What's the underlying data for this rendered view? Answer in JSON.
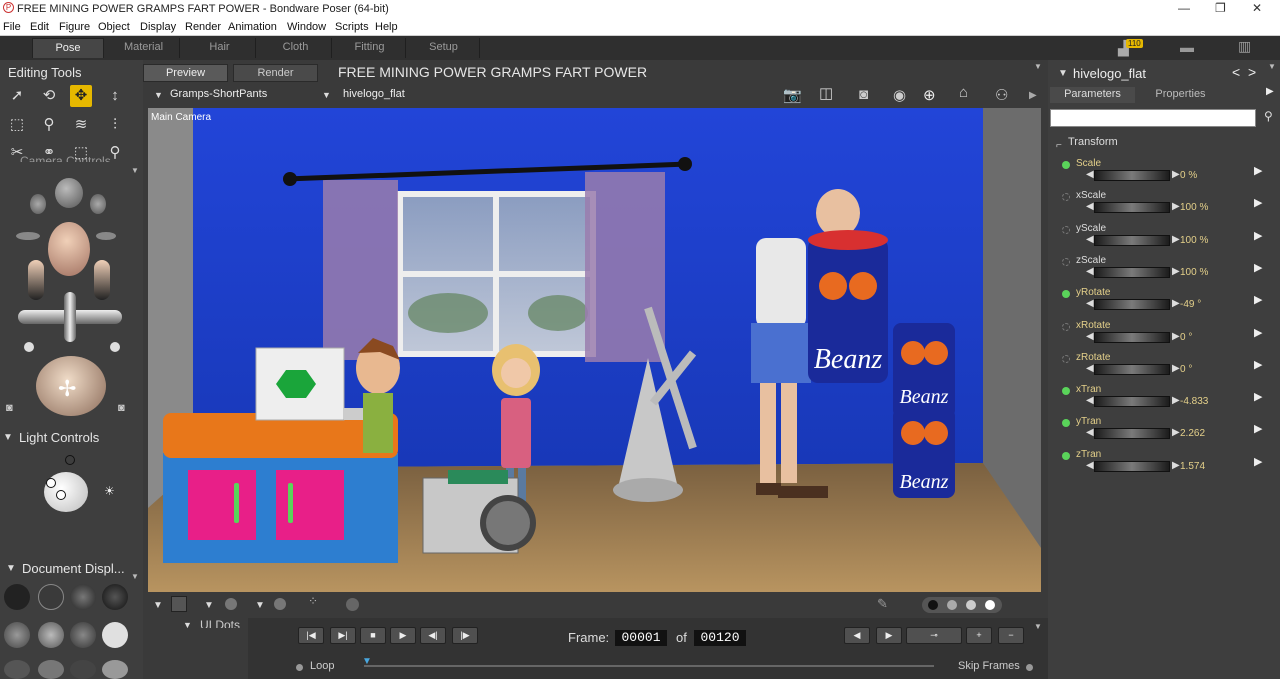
{
  "window": {
    "title": "FREE MINING POWER GRAMPS FART POWER - Bondware Poser (64-bit)"
  },
  "menu": [
    "File",
    "Edit",
    "Figure",
    "Object",
    "Display",
    "Render",
    "Animation",
    "Window",
    "Scripts",
    "Help"
  ],
  "rooms": [
    "Pose",
    "Material",
    "Hair",
    "Cloth",
    "Fitting",
    "Setup"
  ],
  "notification_count": "110",
  "left": {
    "editing_tools": "Editing Tools",
    "camera_controls": "Camera Controls",
    "light_controls": "Light Controls",
    "document_display": "Document Displ...",
    "ui_dots": "UI Dots"
  },
  "center": {
    "tabs": [
      "Preview",
      "Render"
    ],
    "scene_title": "FREE MINING POWER GRAMPS FART POWER",
    "figure_select": "Gramps-ShortPants",
    "actor_select": "hivelogo_flat",
    "camera_label": "Main Camera"
  },
  "timeline": {
    "frame_label": "Frame:",
    "current_frame": "00001",
    "of_label": "of",
    "total_frames": "00120",
    "loop": "Loop",
    "skip_frames": "Skip Frames"
  },
  "right": {
    "actor_name": "hivelogo_flat",
    "tabs": [
      "Parameters",
      "Properties"
    ],
    "group": "Transform",
    "params": [
      {
        "name": "Scale",
        "value": "0 %",
        "color": "#e4d08a",
        "dot": "#5ad45a"
      },
      {
        "name": "xScale",
        "value": "100 %",
        "color": "#ddd",
        "dot": "none"
      },
      {
        "name": "yScale",
        "value": "100 %",
        "color": "#ddd",
        "dot": "none"
      },
      {
        "name": "zScale",
        "value": "100 %",
        "color": "#ddd",
        "dot": "none"
      },
      {
        "name": "yRotate",
        "value": "-49 °",
        "color": "#e4d08a",
        "dot": "#5ad45a"
      },
      {
        "name": "xRotate",
        "value": "0 °",
        "color": "#e4d08a",
        "dot": "none"
      },
      {
        "name": "zRotate",
        "value": "0 °",
        "color": "#e4d08a",
        "dot": "none"
      },
      {
        "name": "xTran",
        "value": "-4.833",
        "color": "#e4d08a",
        "dot": "#5ad45a"
      },
      {
        "name": "yTran",
        "value": "2.262",
        "color": "#e4d08a",
        "dot": "#5ad45a"
      },
      {
        "name": "zTran",
        "value": "1.574",
        "color": "#e4d08a",
        "dot": "#5ad45a"
      }
    ]
  },
  "colors": {
    "accent": "#e6b800",
    "keyed": "#5ad45a",
    "panel": "#3e3e3e",
    "wall": "#1f3fd0",
    "floor": "#9a7a4a"
  }
}
